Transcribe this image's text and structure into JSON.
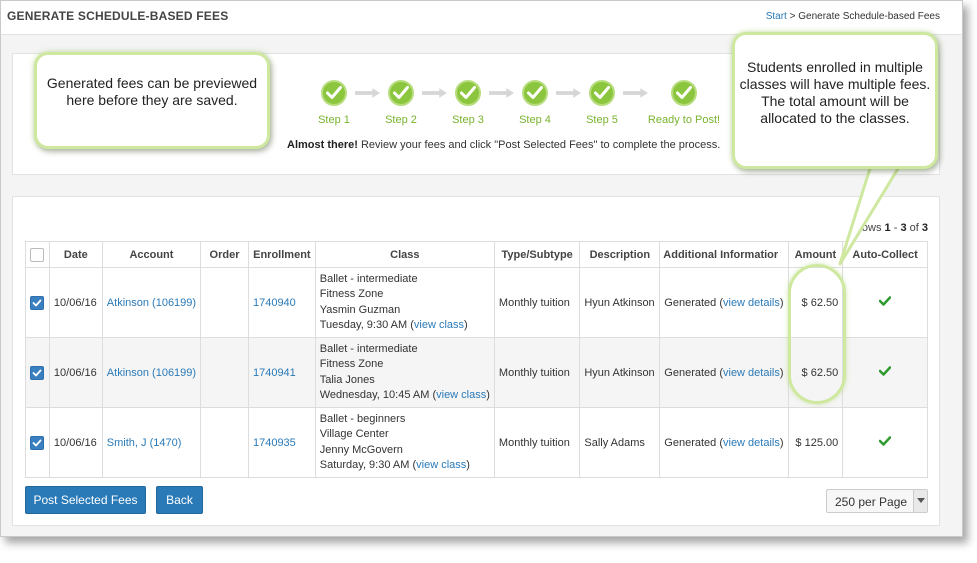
{
  "header": {
    "title": "GENERATE SCHEDULE-BASED FEES",
    "breadcrumb": {
      "start_label": "Start",
      "separator": " > ",
      "current": "Generate Schedule-based Fees"
    }
  },
  "steps": [
    {
      "label": "Step 1"
    },
    {
      "label": "Step 2"
    },
    {
      "label": "Step 3"
    },
    {
      "label": "Step 4"
    },
    {
      "label": "Step 5"
    },
    {
      "label": "Ready to Post!"
    }
  ],
  "process": {
    "bold": "Almost there!",
    "text": " Review your fees and click \"Post Selected Fees\" to complete the process."
  },
  "callouts": {
    "left": "Generated fees can be previewed here before they are saved.",
    "right": "Students enrolled in multiple classes will have multiple fees. The total amount will be allocated to the classes."
  },
  "rows_info": {
    "prefix": "Rows ",
    "from": "1",
    "dash": " - ",
    "to": "3",
    "of": " of ",
    "total": "3"
  },
  "table": {
    "headers": [
      "",
      "Date",
      "Account",
      "Order",
      "Enrollment",
      "Class",
      "Type/Subtype",
      "Description",
      "Additional Informatior",
      "Amount",
      "Auto-Collect"
    ],
    "rows": [
      {
        "checked": true,
        "date": "10/06/16",
        "account": "Atkinson (106199)",
        "order": "",
        "enrollment": "1740940",
        "class_line1": "Ballet - intermediate",
        "class_line2": "Fitness Zone",
        "class_line3": "Yasmin Guzman",
        "class_line4": "Tuesday, 9:30 AM (",
        "class_link": "view class",
        "class_close": ")",
        "type": "Monthly tuition",
        "description": "Hyun Atkinson",
        "info_prefix": "Generated (",
        "info_link": "view details",
        "info_close": ")",
        "amount": "$ 62.50"
      },
      {
        "checked": true,
        "date": "10/06/16",
        "account": "Atkinson (106199)",
        "order": "",
        "enrollment": "1740941",
        "class_line1": "Ballet - intermediate",
        "class_line2": "Fitness Zone",
        "class_line3": "Talia Jones",
        "class_line4": "Wednesday, 10:45 AM (",
        "class_link": "view class",
        "class_close": ")",
        "type": "Monthly tuition",
        "description": "Hyun Atkinson",
        "info_prefix": "Generated (",
        "info_link": "view details",
        "info_close": ")",
        "amount": "$ 62.50"
      },
      {
        "checked": true,
        "date": "10/06/16",
        "account": "Smith, J (1470)",
        "order": "",
        "enrollment": "1740935",
        "class_line1": "Ballet - beginners",
        "class_line2": "Village Center",
        "class_line3": "Jenny McGovern",
        "class_line4": "Saturday, 9:30 AM (",
        "class_link": "view class",
        "class_close": ")",
        "type": "Monthly tuition",
        "description": "Sally Adams",
        "info_prefix": "Generated (",
        "info_link": "view details",
        "info_close": ")",
        "amount": "$ 125.00"
      }
    ]
  },
  "buttons": {
    "post": "Post Selected Fees",
    "back": "Back"
  },
  "pagination": {
    "per_page": "250 per Page"
  },
  "icons": {
    "step": "check-circle-icon",
    "arrow": "arrow-right-icon",
    "auto_collect": "checkmark-icon",
    "dropdown": "chevron-down-icon"
  },
  "colors": {
    "accent": "#2a7ab8",
    "step_green": "#8cc63f",
    "callout_border": "#cfe8a0",
    "check_green": "#2e9a2e"
  }
}
